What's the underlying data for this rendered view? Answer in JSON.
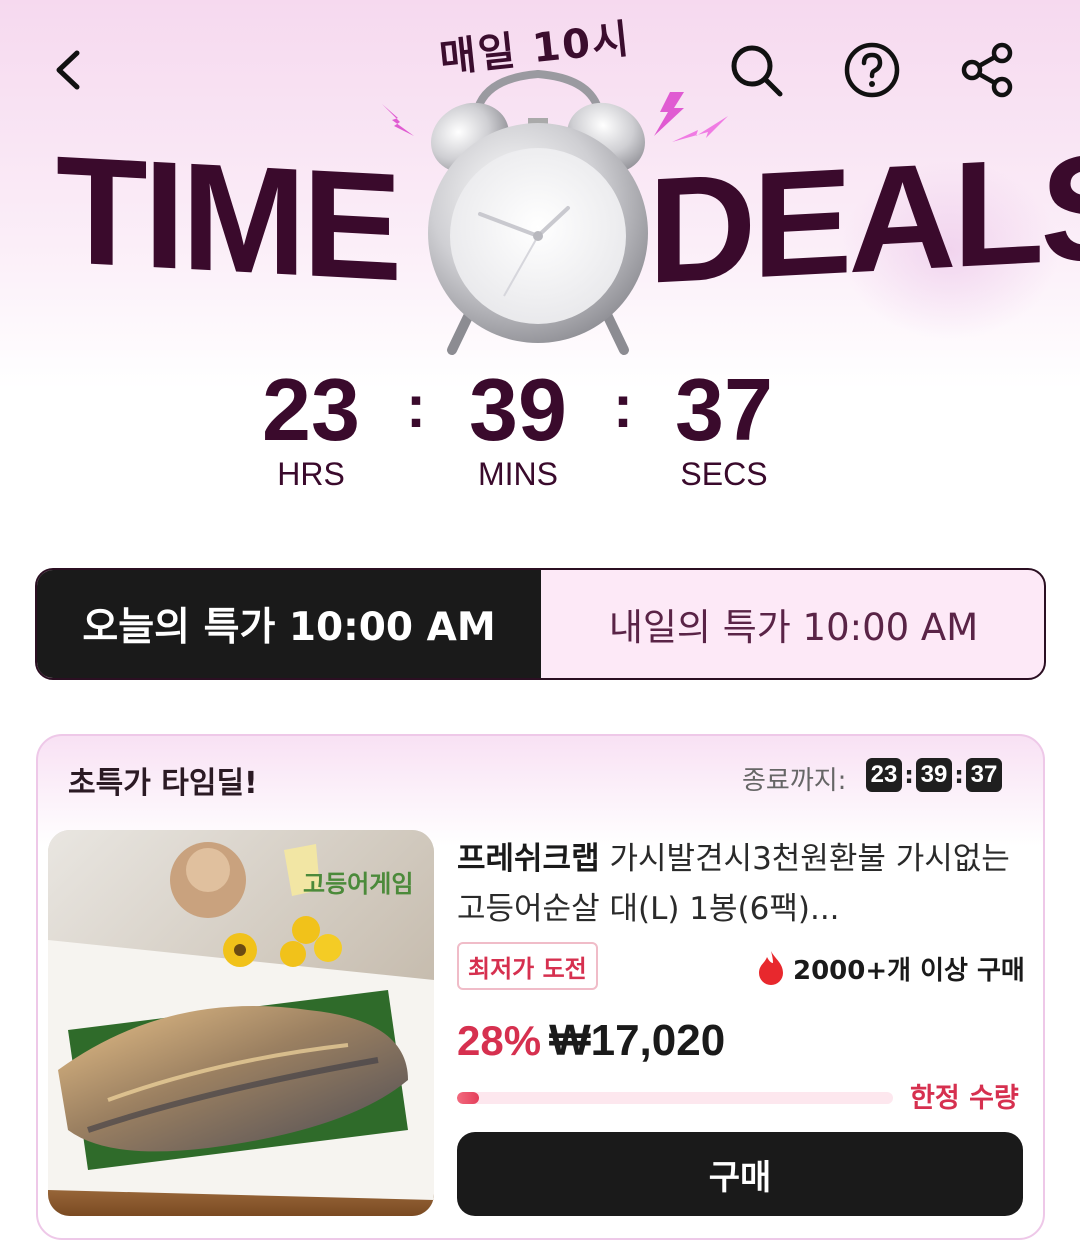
{
  "header": {
    "back_icon": "chevron-left-icon",
    "search_icon": "search-icon",
    "help_icon": "question-circle-icon",
    "share_icon": "share-icon",
    "daily_label": "매일 10시",
    "title_left": "TIME",
    "title_right": "DEALS",
    "clock_icon": "alarm-clock-icon"
  },
  "countdown": {
    "hours": "23",
    "minutes": "39",
    "seconds": "37",
    "separator": ":",
    "hours_label": "HRS",
    "minutes_label": "MINS",
    "seconds_label": "SECS"
  },
  "tabs": [
    {
      "label": "오늘의 특가 10:00 AM",
      "active": true
    },
    {
      "label": "내일의 특가 10:00 AM",
      "active": false
    }
  ],
  "deal": {
    "section_title": "초특가 타임딜!",
    "ends_label": "종료까지:",
    "timer": {
      "hours": "23",
      "minutes": "39",
      "seconds": "37"
    },
    "product": {
      "brand": "프레쉬크랩",
      "name": "가시발견시3천원환불 가시없는 고등어순살 대(L) 1봉(6팩)...",
      "image_text": "고등어게임",
      "badge": "최저가 도전",
      "sold": "2000+개 이상 구매",
      "discount": "28%",
      "price": "₩17,020",
      "stock_progress": 0.05,
      "stock_label": "한정 수량",
      "buy_label": "구매"
    }
  },
  "colors": {
    "brand_dark": "#3a0a2c",
    "accent_red": "#d6304f",
    "hero_pink": "#f6d9ef",
    "tab_active_bg": "#1a1a1a"
  }
}
